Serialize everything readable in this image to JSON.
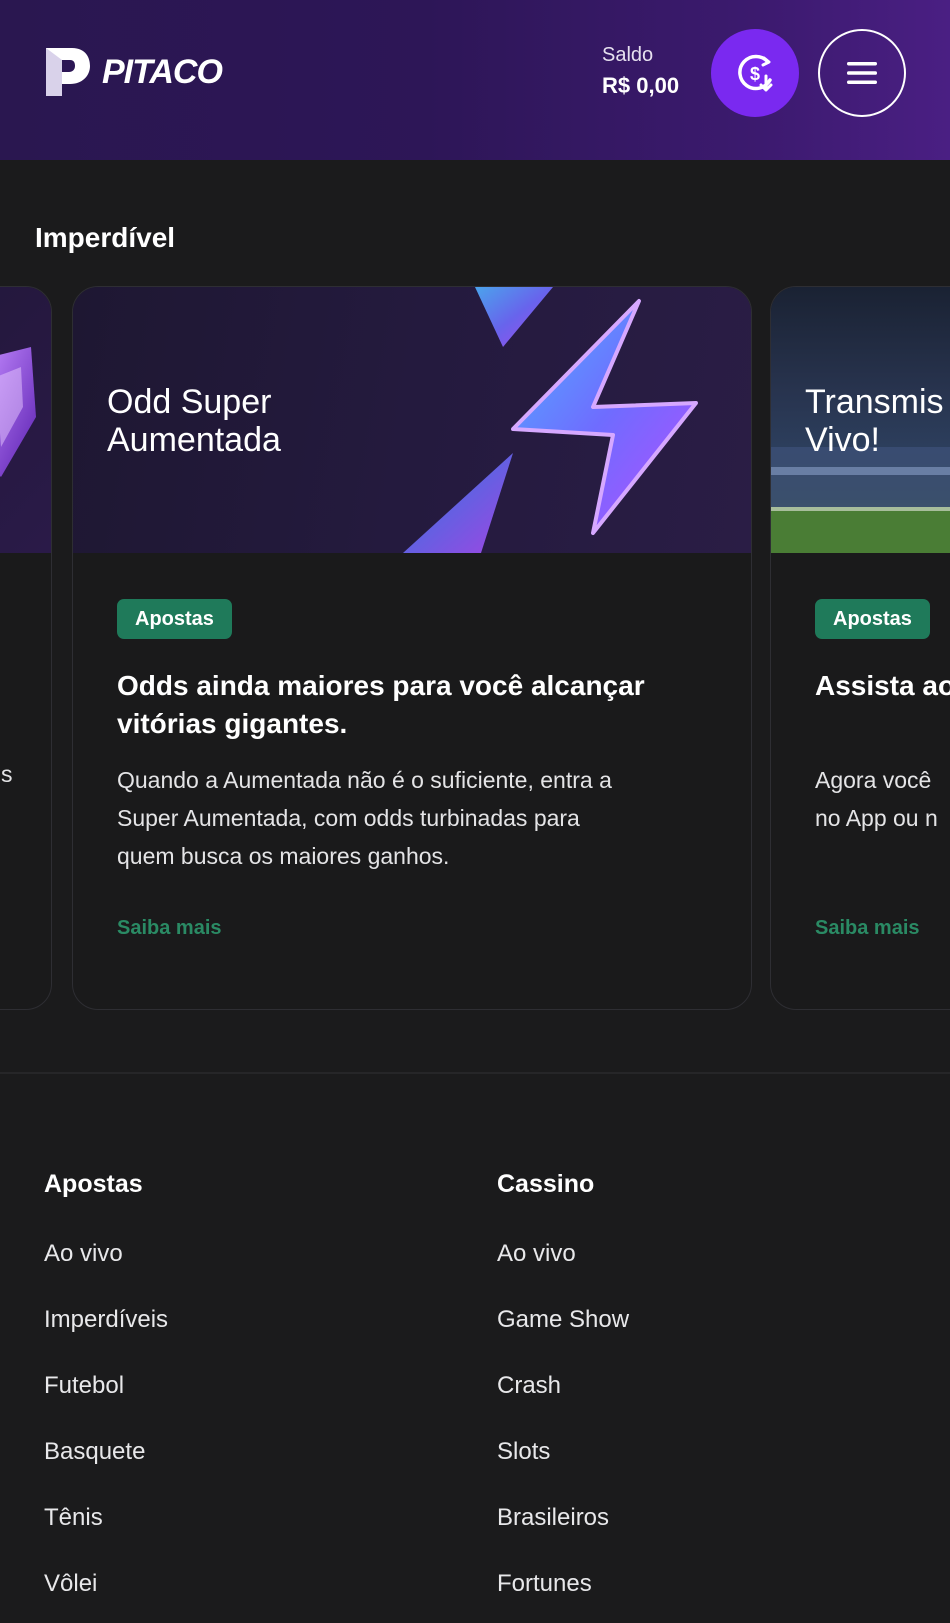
{
  "header": {
    "logo_text": "PITACO",
    "balance_label": "Saldo",
    "balance_value": "R$ 0,00",
    "deposit_icon": "dollar-coin-download-icon",
    "menu_icon": "hamburger-menu-icon"
  },
  "section": {
    "title": "Imperdível"
  },
  "cards": [
    {
      "image_title": "",
      "badge": "",
      "heading": "",
      "description": "s",
      "link": ""
    },
    {
      "image_title_line1": "Odd Super",
      "image_title_line2": "Aumentada",
      "badge": "Apostas",
      "heading_line1": "Odds ainda maiores para você alcançar",
      "heading_line2": "vitórias gigantes.",
      "description_line1": "Quando a Aumentada não é o suficiente, entra a",
      "description_line2": "Super Aumentada, com odds turbinadas para",
      "description_line3": "quem busca os maiores ganhos.",
      "link": "Saiba mais"
    },
    {
      "image_title_line1": "Transmis",
      "image_title_line2": "Vivo!",
      "badge": "Apostas",
      "heading_line1": "Assista ao",
      "description_line1": "Agora você",
      "description_line2": "no App ou n",
      "link": "Saiba mais"
    }
  ],
  "footer": {
    "apostas": {
      "title": "Apostas",
      "links": [
        "Ao vivo",
        "Imperdíveis",
        "Futebol",
        "Basquete",
        "Tênis",
        "Vôlei"
      ]
    },
    "cassino": {
      "title": "Cassino",
      "links": [
        "Ao vivo",
        "Game Show",
        "Crash",
        "Slots",
        "Brasileiros",
        "Fortunes"
      ]
    }
  },
  "colors": {
    "accent_purple": "#7a29f0",
    "badge_green": "#1f7a5a",
    "link_green": "#2a8a64",
    "background": "#1b1b1c"
  }
}
